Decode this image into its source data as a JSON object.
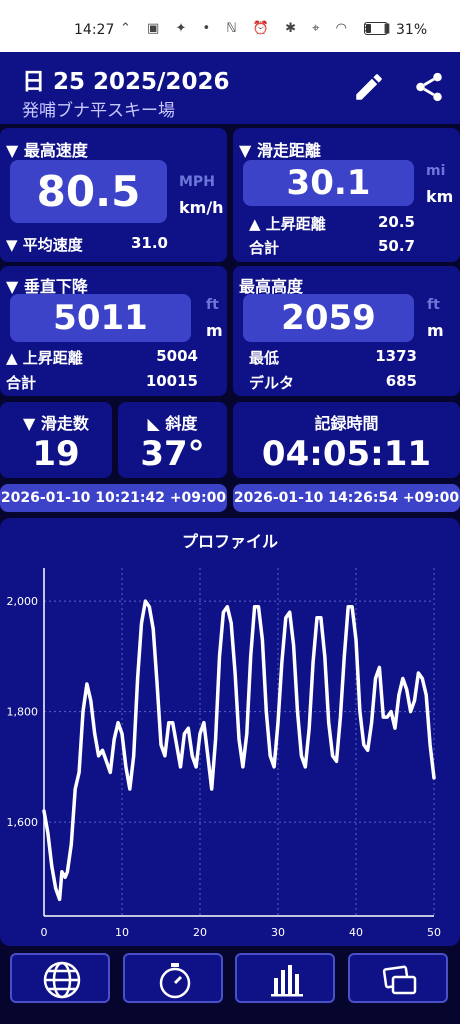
{
  "status_bar": {
    "time": "14:27",
    "icons": "⌃ ▣ ✦ • ℕ ⏰ ✱ ⌖ ◠ ⁝ ▮",
    "battery": "31%"
  },
  "header": {
    "title": "日 25 2025/2026",
    "subtitle": "発哺ブナ平スキー場",
    "edit_icon": "pencil-icon",
    "share_icon": "share-icon"
  },
  "max_speed": {
    "label": "▼ 最高速度",
    "value": "80.5",
    "unit_alt": "MPH",
    "unit": "km/h",
    "avg_label": "▼ 平均速度",
    "avg_value": "31.0"
  },
  "run_distance": {
    "label": "▼ 滑走距離",
    "value": "30.1",
    "unit_alt": "mi",
    "unit": "km",
    "up_label": "▲ 上昇距離",
    "up_value": "20.5",
    "total_label": "合計",
    "total_value": "50.7"
  },
  "vertical_descent": {
    "label": "▼ 垂直下降",
    "value": "5011",
    "unit_alt": "ft",
    "unit": "m",
    "up_label": "▲ 上昇距離",
    "up_value": "5004",
    "total_label": "合計",
    "total_value": "10015"
  },
  "max_altitude": {
    "label": "最高高度",
    "value": "2059",
    "unit_alt": "ft",
    "unit": "m",
    "min_label": "最低",
    "min_value": "1373",
    "delta_label": "デルタ",
    "delta_value": "685"
  },
  "runs": {
    "label": "▼ 滑走数",
    "value": "19"
  },
  "slope": {
    "label": "◣ 斜度",
    "value": "37°"
  },
  "record_time": {
    "label": "記録時間",
    "value": "04:05:11"
  },
  "start_time": "2026-01-10 10:21:42 +09:00",
  "end_time": "2026-01-10 14:26:54 +09:00",
  "nav": {
    "icons": [
      "globe-icon",
      "stopwatch-icon",
      "bar-chart-icon",
      "photos-icon"
    ]
  },
  "chart_data": {
    "type": "line",
    "title": "プロファイル",
    "xlabel": "",
    "ylabel": "",
    "xlim": [
      0,
      50
    ],
    "ylim": [
      1430,
      2060
    ],
    "xticks": [
      0,
      10,
      20,
      30,
      40,
      50
    ],
    "yticks": [
      1600,
      1800,
      2000
    ],
    "ytick_labels": [
      "1,600",
      "1,800",
      "2,000"
    ],
    "grid": true,
    "line_color": "#ffffff",
    "x": [
      0,
      0.5,
      1,
      1.5,
      2,
      2.3,
      2.7,
      3,
      3.5,
      4,
      4.5,
      5,
      5.5,
      6,
      6.5,
      7,
      7.5,
      8,
      8.5,
      9,
      9.5,
      10,
      10.5,
      11,
      11.5,
      12,
      12.5,
      13,
      13.5,
      14,
      14.5,
      15,
      15.5,
      16,
      16.5,
      17,
      17.5,
      18,
      18.5,
      19,
      19.5,
      20,
      20.5,
      21,
      21.5,
      22,
      22.5,
      23,
      23.5,
      24,
      24.5,
      25,
      25.5,
      26,
      26.5,
      27,
      27.5,
      28,
      28.5,
      29,
      29.5,
      30,
      30.5,
      31,
      31.5,
      32,
      32.5,
      33,
      33.5,
      34,
      34.5,
      35,
      35.5,
      36,
      36.5,
      37,
      37.5,
      38,
      38.5,
      39,
      39.5,
      40,
      40.5,
      41,
      41.5,
      42,
      42.5,
      43,
      43.5,
      44,
      44.5,
      45,
      45.5,
      46,
      46.5,
      47,
      47.5,
      48,
      48.5,
      49,
      49.5,
      50
    ],
    "y": [
      1620,
      1580,
      1520,
      1480,
      1460,
      1510,
      1500,
      1510,
      1560,
      1660,
      1690,
      1800,
      1850,
      1820,
      1760,
      1720,
      1730,
      1710,
      1690,
      1750,
      1780,
      1760,
      1700,
      1660,
      1720,
      1860,
      1960,
      2000,
      1990,
      1950,
      1850,
      1740,
      1720,
      1780,
      1780,
      1740,
      1700,
      1760,
      1770,
      1720,
      1700,
      1760,
      1780,
      1720,
      1660,
      1750,
      1900,
      1980,
      1990,
      1960,
      1870,
      1750,
      1700,
      1760,
      1900,
      1990,
      1990,
      1930,
      1800,
      1720,
      1700,
      1780,
      1890,
      1970,
      1980,
      1920,
      1800,
      1720,
      1700,
      1770,
      1890,
      1970,
      1970,
      1900,
      1780,
      1720,
      1710,
      1790,
      1900,
      1990,
      1990,
      1930,
      1800,
      1740,
      1730,
      1780,
      1860,
      1880,
      1790,
      1790,
      1800,
      1770,
      1830,
      1860,
      1840,
      1800,
      1820,
      1870,
      1860,
      1830,
      1740,
      1680
    ]
  }
}
